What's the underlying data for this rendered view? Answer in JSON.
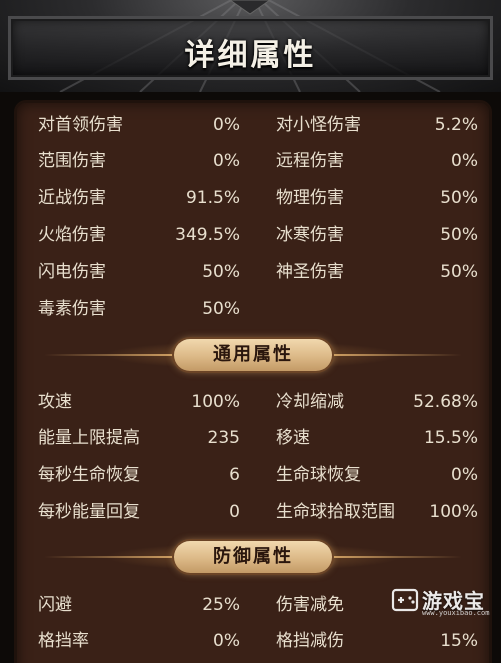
{
  "header": {
    "title": "详细属性"
  },
  "damage_stats": {
    "left": [
      {
        "label": "对首领伤害",
        "value": "0%"
      },
      {
        "label": "范围伤害",
        "value": "0%"
      },
      {
        "label": "近战伤害",
        "value": "91.5%"
      },
      {
        "label": "火焰伤害",
        "value": "349.5%"
      },
      {
        "label": "闪电伤害",
        "value": "50%"
      },
      {
        "label": "毒素伤害",
        "value": "50%"
      }
    ],
    "right": [
      {
        "label": "对小怪伤害",
        "value": "5.2%"
      },
      {
        "label": "远程伤害",
        "value": "0%"
      },
      {
        "label": "物理伤害",
        "value": "50%"
      },
      {
        "label": "冰寒伤害",
        "value": "50%"
      },
      {
        "label": "神圣伤害",
        "value": "50%"
      }
    ]
  },
  "general_section": {
    "title": "通用属性",
    "left": [
      {
        "label": "攻速",
        "value": "100%"
      },
      {
        "label": "能量上限提高",
        "value": "235"
      },
      {
        "label": "每秒生命恢复",
        "value": "6"
      },
      {
        "label": "每秒能量回复",
        "value": "0"
      }
    ],
    "right": [
      {
        "label": "冷却缩减",
        "value": "52.68%"
      },
      {
        "label": "移速",
        "value": "15.5%"
      },
      {
        "label": "生命球恢复",
        "value": "0%"
      },
      {
        "label": "生命球拾取范围",
        "value": "100%"
      }
    ]
  },
  "defense_section": {
    "title": "防御属性",
    "left": [
      {
        "label": "闪避",
        "value": "25%"
      },
      {
        "label": "格挡率",
        "value": "0%"
      }
    ],
    "right": [
      {
        "label": "伤害减免",
        "value": ""
      },
      {
        "label": "格挡减伤",
        "value": "15%"
      }
    ]
  },
  "watermark": {
    "icon": "gamepad-icon",
    "text": "游戏宝",
    "url": "www.youxibao.com"
  },
  "colors": {
    "panel_bg": "#3a2117",
    "text": "#e8dfce",
    "pill_bg": "#dcb987",
    "pill_text": "#2a160d"
  }
}
